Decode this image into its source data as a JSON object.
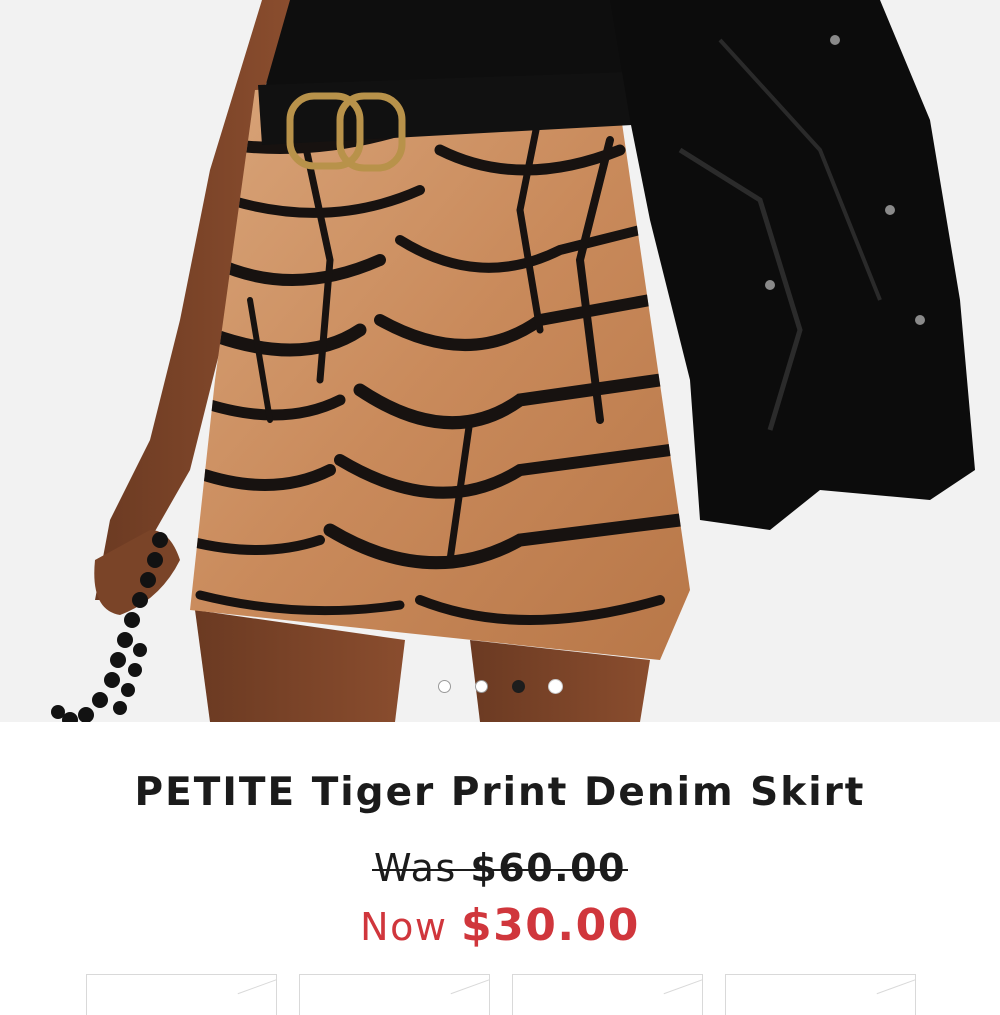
{
  "product": {
    "title": "PETITE Tiger Print Denim Skirt",
    "was_label": "Was",
    "was_price": "$60.00",
    "now_label": "Now",
    "now_price": "$30.00"
  },
  "carousel": {
    "slide_count": 4,
    "active_index": 2
  },
  "colors": {
    "sale_red": "#d0363c",
    "text": "#1b1b1b",
    "hero_background": "#f2f2f2"
  },
  "size_options_count": 4
}
